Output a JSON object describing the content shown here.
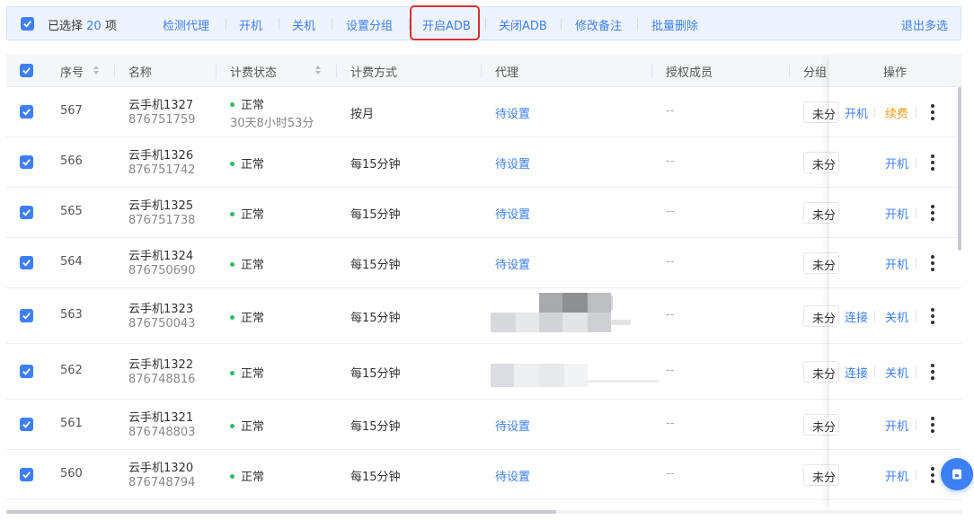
{
  "selection_bar": {
    "selected_prefix": "已选择",
    "selected_count": "20",
    "selected_suffix": "项",
    "actions": [
      "检测代理",
      "开机",
      "关机",
      "设置分组",
      "开启ADB",
      "关闭ADB",
      "修改备注",
      "批量删除"
    ],
    "exit_label": "退出多选"
  },
  "columns": [
    "序号",
    "名称",
    "计费状态",
    "计费方式",
    "代理",
    "授权成员",
    "分组",
    "操作"
  ],
  "rows": [
    {
      "seq": "567",
      "name": "云手机1327",
      "id": "876751759",
      "status": "正常",
      "status_extra": "30天8小时53分",
      "billing": "按月",
      "proxy": "待设置",
      "members": "--",
      "group": "未分",
      "ops": [
        "开机",
        "续费"
      ]
    },
    {
      "seq": "566",
      "name": "云手机1326",
      "id": "876751742",
      "status": "正常",
      "status_extra": "",
      "billing": "每15分钟",
      "proxy": "待设置",
      "members": "--",
      "group": "未分",
      "ops": [
        "开机"
      ]
    },
    {
      "seq": "565",
      "name": "云手机1325",
      "id": "876751738",
      "status": "正常",
      "status_extra": "",
      "billing": "每15分钟",
      "proxy": "待设置",
      "members": "--",
      "group": "未分",
      "ops": [
        "开机"
      ]
    },
    {
      "seq": "564",
      "name": "云手机1324",
      "id": "876750690",
      "status": "正常",
      "status_extra": "",
      "billing": "每15分钟",
      "proxy": "待设置",
      "members": "--",
      "group": "未分",
      "ops": [
        "开机"
      ]
    },
    {
      "seq": "563",
      "name": "云手机1323",
      "id": "876750043",
      "status": "正常",
      "status_extra": "",
      "billing": "每15分钟",
      "proxy": "",
      "members": "--",
      "group": "未分",
      "ops": [
        "连接",
        "关机"
      ]
    },
    {
      "seq": "562",
      "name": "云手机1322",
      "id": "876748816",
      "status": "正常",
      "status_extra": "",
      "billing": "每15分钟",
      "proxy": "",
      "members": "--",
      "group": "未分",
      "ops": [
        "连接",
        "关机"
      ]
    },
    {
      "seq": "561",
      "name": "云手机1321",
      "id": "876748803",
      "status": "正常",
      "status_extra": "",
      "billing": "每15分钟",
      "proxy": "待设置",
      "members": "--",
      "group": "未分",
      "ops": [
        "开机"
      ]
    },
    {
      "seq": "560",
      "name": "云手机1320",
      "id": "876748794",
      "status": "正常",
      "status_extra": "",
      "billing": "每15分钟",
      "proxy": "待设置",
      "members": "--",
      "group": "未分",
      "ops": [
        "开机"
      ]
    }
  ],
  "colors": {
    "accent": "#3d7ff5",
    "highlight": "#d9302c",
    "success": "#2fb86a",
    "renew": "#f0a020"
  }
}
